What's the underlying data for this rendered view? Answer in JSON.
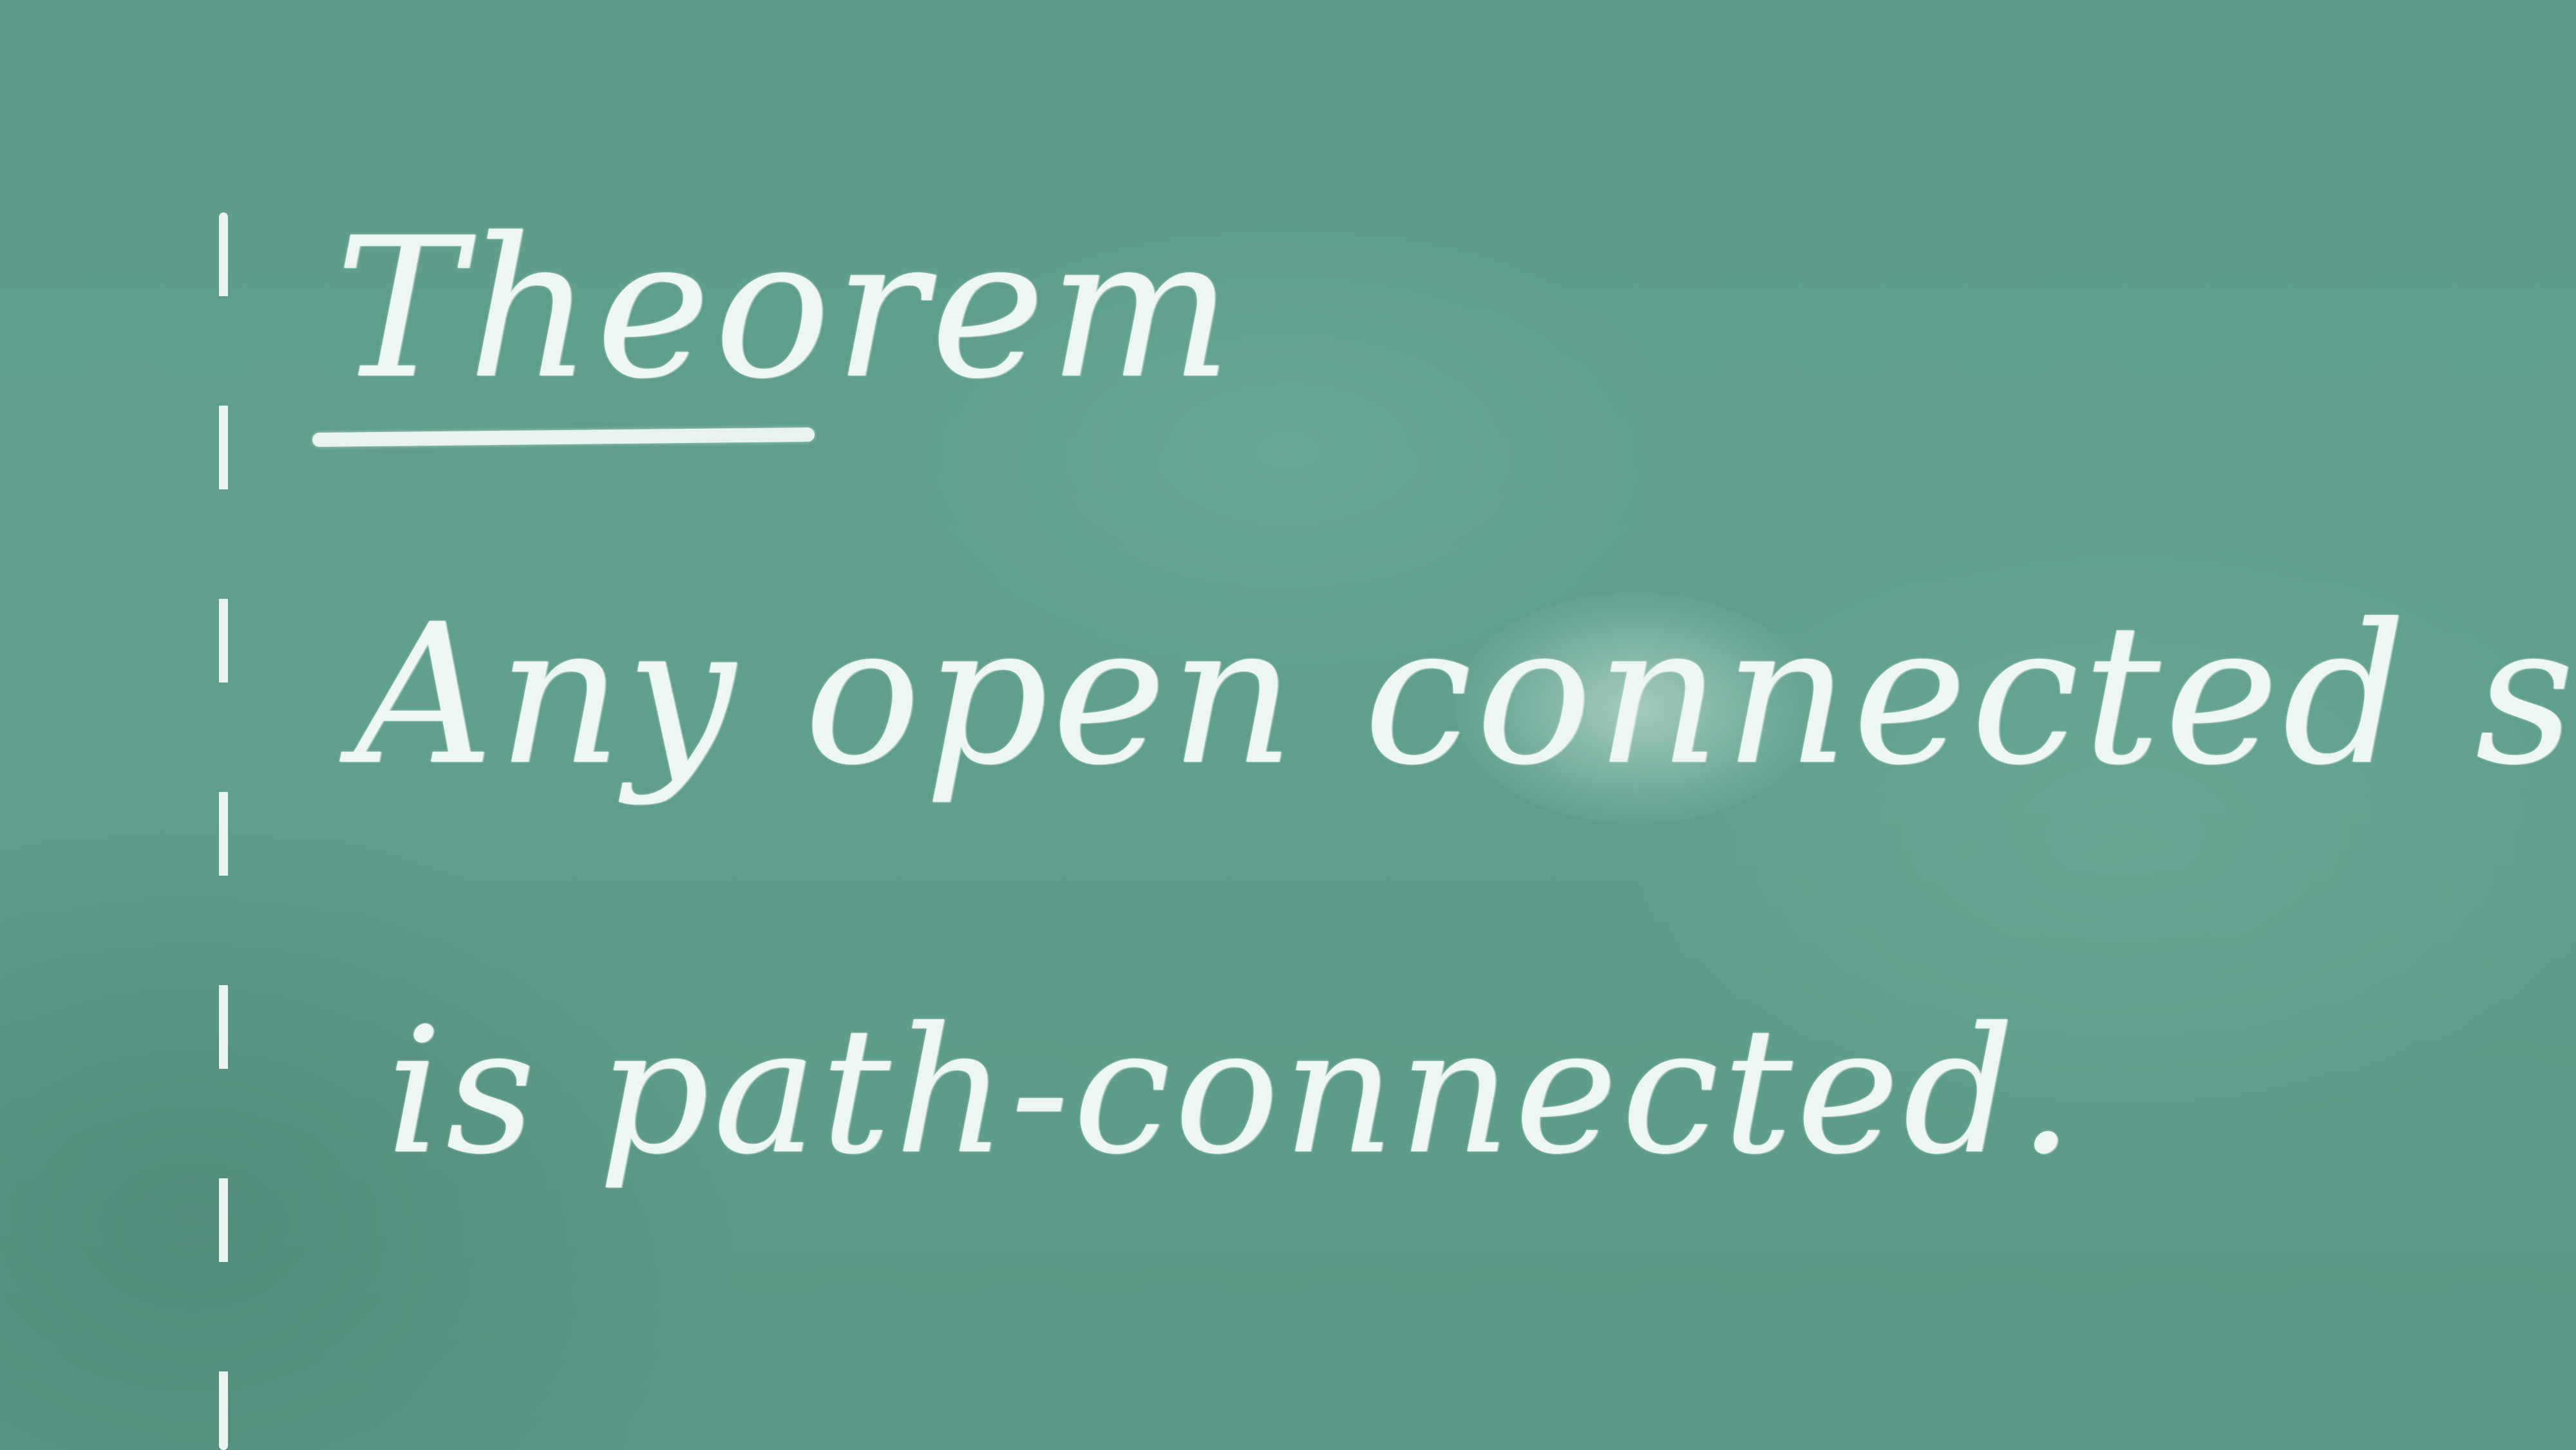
{
  "board": {
    "background_color": "#5f9f8f",
    "chalk_color": "#eef6f2",
    "heading": "Theorem",
    "line1": "Any open connected subset of ℝⁿ.",
    "line2": "is path-connected."
  }
}
